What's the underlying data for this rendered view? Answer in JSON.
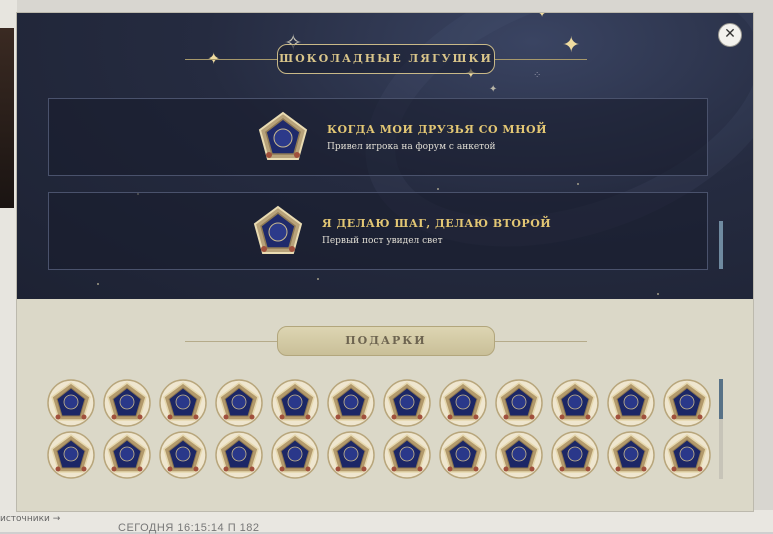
{
  "modal": {
    "close_symbol": "✕",
    "frogs_section": {
      "title": "ШОКОЛАДНЫЕ ЛЯГУШКИ",
      "achievements": [
        {
          "name": "КОГДА МОИ ДРУЗЬЯ СО МНОЙ",
          "description": "Привел игрока на форум с анкетой",
          "icon": "chocolate-frog-card-icon"
        },
        {
          "name": "Я ДЕЛАЮ ШАГ, ДЕЛАЮ ВТОРОЙ",
          "description": "Первый пост увидел свет",
          "icon": "chocolate-frog-card-icon"
        }
      ]
    },
    "gifts_section": {
      "title": "ПОДАРКИ",
      "gift_rows": 2,
      "gifts_per_row": 12,
      "gift_icon": "chocolate-frog-card-icon"
    }
  },
  "background_page": {
    "sources_link": "источники →",
    "today_line": "СЕГОДНЯ 16:15:14   П 182"
  },
  "colors": {
    "night_panel": "#252b40",
    "parchment_panel": "#dbd8c8",
    "gold_text": "#e3c774",
    "scroll_thumb": "#587287"
  }
}
